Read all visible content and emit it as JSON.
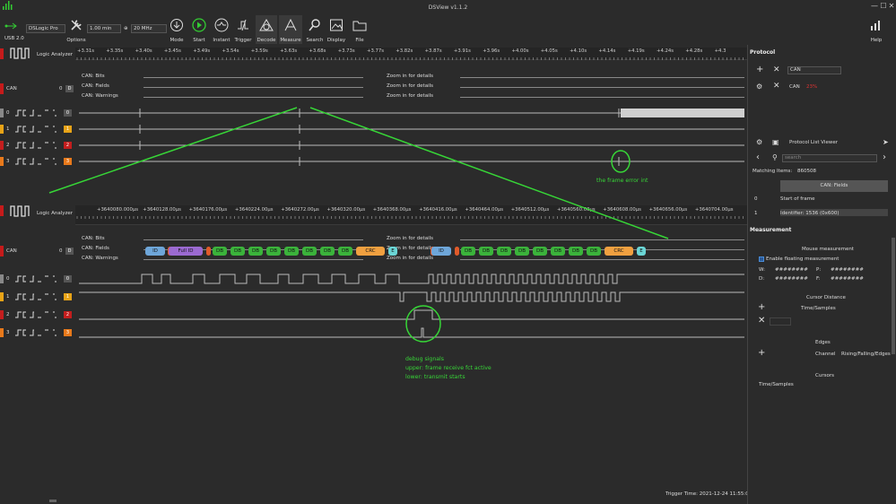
{
  "window": {
    "title": "DSView v1.1.2",
    "min": "—",
    "max": "☐",
    "close": "✕"
  },
  "toolbar": {
    "usb": "USB 2.0",
    "device": "DSLogic Pro",
    "options": "Options",
    "duration": "1.00 min",
    "rate": "20 MHz",
    "mode": "Mode",
    "start": "Start",
    "instant": "Instant",
    "trigger": "Trigger",
    "decode": "Decode",
    "measure": "Measure",
    "search": "Search",
    "display": "Display",
    "file": "File",
    "help": "Help"
  },
  "top_view": {
    "logic_label": "Logic Analyzer",
    "ticks": [
      "+3.31s",
      "+3.35s",
      "+3.40s",
      "+3.45s",
      "+3.49s",
      "+3.54s",
      "+3.59s",
      "+3.63s",
      "+3.68s",
      "+3.73s",
      "+3.77s",
      "+3.82s",
      "+3.87s",
      "+3.91s",
      "+3.96s",
      "+4.00s",
      "+4.05s",
      "+4.10s",
      "+4.14s",
      "+4.19s",
      "+4.24s",
      "+4.28s",
      "+4.3"
    ],
    "can_label": "CAN",
    "can_d": "D",
    "can_num": "0",
    "decoder_rows": [
      "CAN: Bits",
      "CAN: Fields",
      "CAN: Warnings"
    ],
    "zoom_msg": "Zoom in for details",
    "channels": [
      "0",
      "1",
      "2",
      "3"
    ]
  },
  "bottom_view": {
    "logic_label": "Logic Analyzer",
    "ticks": [
      "+3640080.000µs",
      "+3640128.00µs",
      "+3640176.00µs",
      "+3640224.00µs",
      "+3640272.00µs",
      "+3640320.00µs",
      "+3640368.00µs",
      "+3640416.00µs",
      "+3640464.00µs",
      "+3640512.00µs",
      "+3640560.00µs",
      "+3640608.00µs",
      "+3640656.00µs",
      "+3640704.00µs"
    ],
    "decoder_rows": [
      "CAN: Bits",
      "CAN: Fields",
      "CAN: Warnings"
    ],
    "zoom_msg": "Zoom in for details",
    "fields": [
      "ID",
      "Full ID",
      "DB",
      "DB",
      "DB",
      "DB",
      "DB",
      "DB",
      "DB",
      "DB",
      "CRC",
      "E",
      "ID",
      "DB",
      "DB",
      "DB",
      "DB",
      "DB",
      "DB",
      "DB",
      "DB",
      "CRC",
      "E"
    ],
    "channels": [
      "0",
      "1",
      "2",
      "3"
    ]
  },
  "annotations": {
    "frame_error": "the frame error int",
    "debug1": "debug signals",
    "debug2": "upper: frame receive fct active",
    "debug3": "lower: transmit starts"
  },
  "protocol": {
    "title": "Protocol",
    "add_value": "CAN",
    "row_value": "CAN",
    "row_pct": "23%",
    "list_title": "Protocol List Viewer",
    "search_placeholder": "search",
    "matching_label": "Matching Items:",
    "matching_count": "860508",
    "col_header": "CAN: Fields",
    "items": [
      {
        "idx": "0",
        "text": "Start of frame"
      },
      {
        "idx": "1",
        "text": "Identifier: 1536 (0x600)"
      }
    ]
  },
  "measurement": {
    "title": "Measurement",
    "mouse": "Mouse measurement",
    "float": "Enable floating measurement",
    "w_label": "W:",
    "w_val": "########",
    "p_label": "P:",
    "p_val": "########",
    "d_label": "D:",
    "d_val": "########",
    "f_label": "F:",
    "f_val": "########",
    "cursor_distance": "Cursor Distance",
    "time_samples": "Time/Samples",
    "edges": "Edges",
    "channel": "Channel",
    "edge_type": "Rising/Falling/Edges",
    "cursors": "Cursors",
    "cursors_ts": "Time/Samples"
  },
  "status": {
    "trigger_time": "Trigger Time: 2021-12-24 11:55:02"
  },
  "colors": {
    "ch0": "#555555",
    "ch1": "#e8a317",
    "ch2": "#c41e1e",
    "ch3": "#e8791b",
    "annotation": "#37d637"
  }
}
